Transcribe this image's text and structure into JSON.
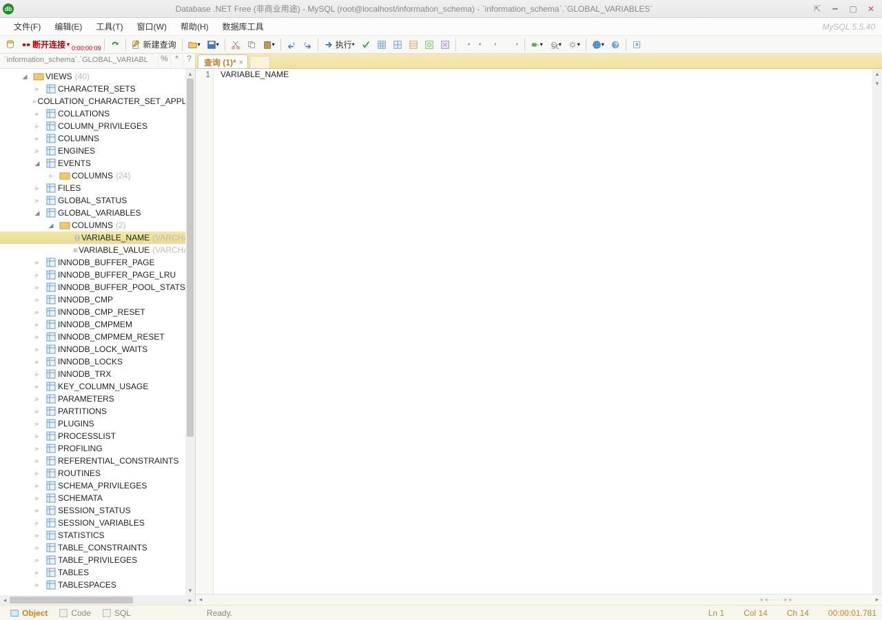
{
  "title": "Database .NET Free (非商业用途) - MySQL (root@localhost/information_schema) - `information_schema`.`GLOBAL_VARIABLES`",
  "version": "MySQL 5.5.40",
  "menu": {
    "file": "文件(F)",
    "edit": "编辑(E)",
    "tools": "工具(T)",
    "window": "窗口(W)",
    "help": "帮助(H)",
    "dbtools": "数据库工具"
  },
  "toolbar": {
    "disconnect": "断开连接",
    "timer": "0:00:00:09",
    "newquery": "新建查询",
    "execute": "执行"
  },
  "sideTab": {
    "label": "`information_schema`.`GLOBAL_VARIABL",
    "pct": "%",
    "star": "*",
    "q": "?"
  },
  "tree": {
    "root": {
      "label": "VIEWS",
      "count": "(40)"
    },
    "views": [
      "CHARACTER_SETS",
      "COLLATION_CHARACTER_SET_APPLICABILITY",
      "COLLATIONS",
      "COLUMN_PRIVILEGES",
      "COLUMNS",
      "ENGINES"
    ],
    "events": {
      "label": "EVENTS",
      "cols": "COLUMNS",
      "colsCount": "(24)"
    },
    "files": "FILES",
    "gstatus": "GLOBAL_STATUS",
    "gvars": {
      "label": "GLOBAL_VARIABLES",
      "cols": "COLUMNS",
      "colsCount": "(2)",
      "c1": {
        "name": "VARIABLE_NAME",
        "type": "(VARCHAR"
      },
      "c2": {
        "name": "VARIABLE_VALUE",
        "type": "(VARCHAR"
      }
    },
    "after": [
      "INNODB_BUFFER_PAGE",
      "INNODB_BUFFER_PAGE_LRU",
      "INNODB_BUFFER_POOL_STATS",
      "INNODB_CMP",
      "INNODB_CMP_RESET",
      "INNODB_CMPMEM",
      "INNODB_CMPMEM_RESET",
      "INNODB_LOCK_WAITS",
      "INNODB_LOCKS",
      "INNODB_TRX",
      "KEY_COLUMN_USAGE",
      "PARAMETERS",
      "PARTITIONS",
      "PLUGINS",
      "PROCESSLIST",
      "PROFILING",
      "REFERENTIAL_CONSTRAINTS",
      "ROUTINES",
      "SCHEMA_PRIVILEGES",
      "SCHEMATA",
      "SESSION_STATUS",
      "SESSION_VARIABLES",
      "STATISTICS",
      "TABLE_CONSTRAINTS",
      "TABLE_PRIVILEGES",
      "TABLES",
      "TABLESPACES"
    ]
  },
  "editor": {
    "tab": "查询 (1)*",
    "line1": "1",
    "code": "VARIABLE_NAME"
  },
  "status": {
    "object": "Object",
    "code": "Code",
    "sql": "SQL",
    "ready": "Ready.",
    "ln": "Ln 1",
    "col": "Col 14",
    "ch": "Ch 14",
    "time": "00:00:01.781"
  }
}
